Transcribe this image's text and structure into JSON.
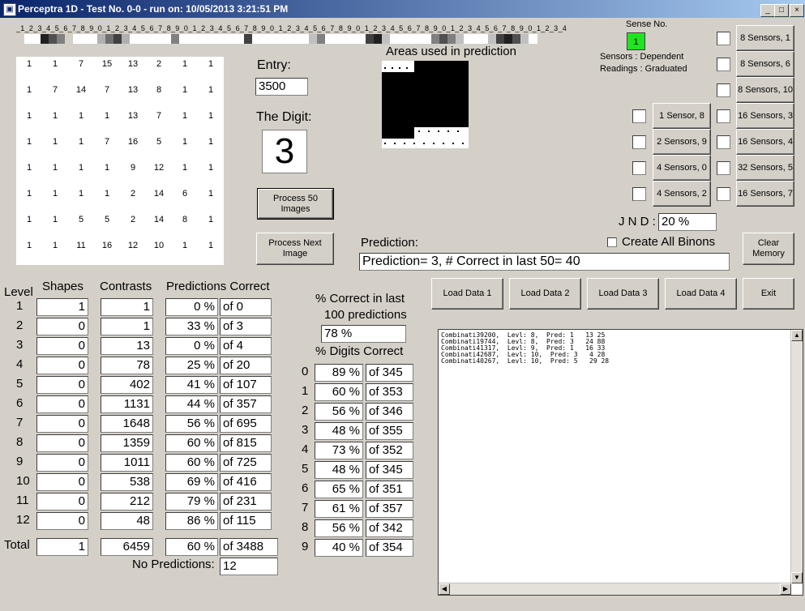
{
  "window": {
    "title": "Perceptra 1D - Test No. 0-0 - run on: 10/05/2013  3:21:51 PM",
    "icon": "app-icon",
    "controls": [
      "_",
      "□",
      "×"
    ]
  },
  "ruler": {
    "text": "_1_2_3_4_5_6_7_8_9_0_1_2_3_4_5_6_7_8_9_0_1_2_3_4_5_6_7_8_9_0_1_2_3_4_5_6_7_8_9_0_1_2_3_4_5_6_7_8_9_0_1_2_3_4_5_6_7_8_9_0_1_2_3_4"
  },
  "strip": {
    "colors": [
      "#d4d0c8",
      "#fff",
      "#fff",
      "#202020",
      "#505050",
      "#808080",
      "#d4d0c8",
      "#fff",
      "#fff",
      "#fff",
      "#b0b0b0",
      "#707070",
      "#404040",
      "#b0b0b0",
      "#fff",
      "#fff",
      "#fff",
      "#fff",
      "#fff",
      "#808080",
      "#fff",
      "#fff",
      "#fff",
      "#fff",
      "#fff",
      "#fff",
      "#fff",
      "#fff",
      "#404040",
      "#fff",
      "#fff",
      "#fff",
      "#fff",
      "#fff",
      "#fff",
      "#fff",
      "#c0c0c0",
      "#808080",
      "#fff",
      "#fff",
      "#fff",
      "#fff",
      "#fff",
      "#404040",
      "#202020",
      "#c0c0c0",
      "#fff",
      "#fff",
      "#fff",
      "#fff",
      "#fff",
      "#808080",
      "#505050",
      "#808080",
      "#c0c0c0",
      "#fff",
      "#fff",
      "#fff",
      "#c0c0c0",
      "#404040",
      "#202020",
      "#505050",
      "#c0c0c0",
      "#fff"
    ]
  },
  "grid": {
    "rows": [
      [
        "1",
        "1",
        "7",
        "15",
        "13",
        "2",
        "1",
        "1"
      ],
      [
        "1",
        "7",
        "14",
        "7",
        "13",
        "8",
        "1",
        "1"
      ],
      [
        "1",
        "1",
        "1",
        "1",
        "13",
        "7",
        "1",
        "1"
      ],
      [
        "1",
        "1",
        "1",
        "7",
        "16",
        "5",
        "1",
        "1"
      ],
      [
        "1",
        "1",
        "1",
        "1",
        "9",
        "12",
        "1",
        "1"
      ],
      [
        "1",
        "1",
        "1",
        "1",
        "2",
        "14",
        "6",
        "1"
      ],
      [
        "1",
        "1",
        "5",
        "5",
        "2",
        "14",
        "8",
        "1"
      ],
      [
        "1",
        "1",
        "11",
        "16",
        "12",
        "10",
        "1",
        "1"
      ]
    ]
  },
  "entry": {
    "label": "Entry:",
    "value": "3500"
  },
  "digit": {
    "label": "The Digit:",
    "value": "3"
  },
  "areas": {
    "label": "Areas used in prediction"
  },
  "sense": {
    "label": "Sense No.",
    "value": "1",
    "sensors_line": "Sensors  :  Dependent",
    "readings_line": "Readings : Graduated",
    "indicator_color": "#22e322"
  },
  "sensor_buttons": {
    "right": [
      "8 Sensors, 1",
      "8 Sensors, 6",
      "8 Sensors, 10",
      "16 Sensors, 3",
      "16 Sensors, 4",
      "32 Sensors, 5",
      "16 Sensors, 7"
    ],
    "left": [
      "1 Sensor, 8",
      "2 Sensors, 9",
      "4 Sensors, 0",
      "4 Sensors, 2"
    ]
  },
  "jnd": {
    "label": "J N D :",
    "value": "20 %"
  },
  "create_all_binons": {
    "label": "Create All Binons",
    "checked": false
  },
  "buttons": {
    "clear_memory": "Clear Memory",
    "process_50": "Process 50 Images",
    "process_next": "Process Next Image",
    "load1": "Load Data 1",
    "load2": "Load Data 2",
    "load3": "Load Data 3",
    "load4": "Load Data 4",
    "exit": "Exit"
  },
  "prediction": {
    "label": "Prediction:",
    "value": "Prediction= 3, # Correct in last 50= 40"
  },
  "table": {
    "headers": {
      "level": "Level",
      "shapes": "Shapes",
      "contrasts": "Contrasts",
      "predictions_correct": "Predictions Correct"
    },
    "rows": [
      {
        "level": "1",
        "shapes": "1",
        "contrasts": "1",
        "pct": "0 %",
        "of": "of 0"
      },
      {
        "level": "2",
        "shapes": "0",
        "contrasts": "1",
        "pct": "33 %",
        "of": "of 3"
      },
      {
        "level": "3",
        "shapes": "0",
        "contrasts": "13",
        "pct": "0 %",
        "of": "of 4"
      },
      {
        "level": "4",
        "shapes": "0",
        "contrasts": "78",
        "pct": "25 %",
        "of": "of 20"
      },
      {
        "level": "5",
        "shapes": "0",
        "contrasts": "402",
        "pct": "41 %",
        "of": "of 107"
      },
      {
        "level": "6",
        "shapes": "0",
        "contrasts": "1131",
        "pct": "44 %",
        "of": "of 357"
      },
      {
        "level": "7",
        "shapes": "0",
        "contrasts": "1648",
        "pct": "56 %",
        "of": "of 695"
      },
      {
        "level": "8",
        "shapes": "0",
        "contrasts": "1359",
        "pct": "60 %",
        "of": "of 815"
      },
      {
        "level": "9",
        "shapes": "0",
        "contrasts": "1011",
        "pct": "60 %",
        "of": "of 725"
      },
      {
        "level": "10",
        "shapes": "0",
        "contrasts": "538",
        "pct": "69 %",
        "of": "of 416"
      },
      {
        "level": "11",
        "shapes": "0",
        "contrasts": "212",
        "pct": "79 %",
        "of": "of 231"
      },
      {
        "level": "12",
        "shapes": "0",
        "contrasts": "48",
        "pct": "86 %",
        "of": "of 115"
      }
    ],
    "total": {
      "label": "Total",
      "shapes": "1",
      "contrasts": "6459",
      "pct": "60 %",
      "of": "of 3488"
    },
    "no_predictions": {
      "label": "No Predictions:",
      "value": "12"
    }
  },
  "pct_correct": {
    "label1": "% Correct in last",
    "label2": "100 predictions",
    "value": "78 %"
  },
  "digits_correct": {
    "label": "% Digits Correct",
    "rows": [
      {
        "digit": "0",
        "pct": "89 %",
        "of": "of 345"
      },
      {
        "digit": "1",
        "pct": "60 %",
        "of": "of 353"
      },
      {
        "digit": "2",
        "pct": "56 %",
        "of": "of 346"
      },
      {
        "digit": "3",
        "pct": "48 %",
        "of": "of 355"
      },
      {
        "digit": "4",
        "pct": "73 %",
        "of": "of 352"
      },
      {
        "digit": "5",
        "pct": "48 %",
        "of": "of 345"
      },
      {
        "digit": "6",
        "pct": "65 %",
        "of": "of 351"
      },
      {
        "digit": "7",
        "pct": "61 %",
        "of": "of 357"
      },
      {
        "digit": "8",
        "pct": "56 %",
        "of": "of 342"
      },
      {
        "digit": "9",
        "pct": "40 %",
        "of": "of 354"
      }
    ]
  },
  "log": {
    "lines": [
      "Combinati39200,  Levl: 8,  Pred: 1   13 25",
      "Combinati19744,  Levl: 8,  Pred: 3   24 88",
      "Combinati41317,  Levl: 9,  Pred: 1   16 33",
      "Combinati42687,  Levl: 10,  Pred: 3   4 28",
      "Combinati40267,  Levl: 10,  Pred: 5   29 28"
    ]
  }
}
